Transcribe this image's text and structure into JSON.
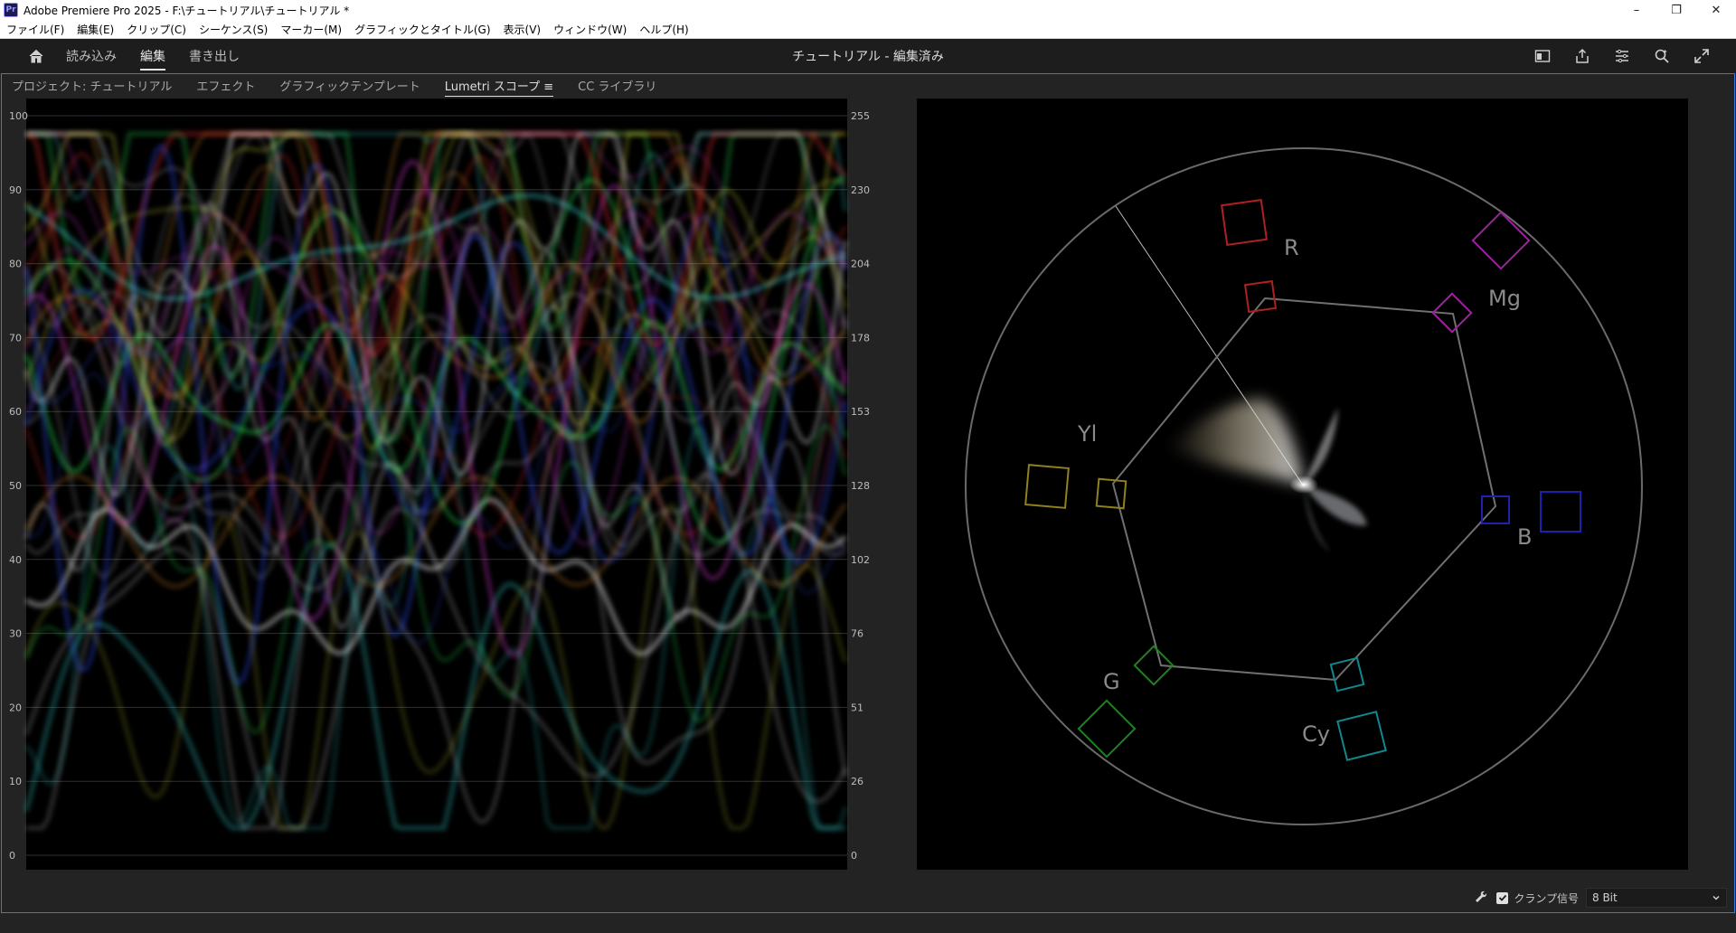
{
  "window": {
    "title": "Adobe Premiere Pro 2025 - F:\\チュートリアル\\チュートリアル *",
    "app_badge": "Pr"
  },
  "menu": [
    "ファイル(F)",
    "編集(E)",
    "クリップ(C)",
    "シーケンス(S)",
    "マーカー(M)",
    "グラフィックとタイトル(G)",
    "表示(V)",
    "ウィンドウ(W)",
    "ヘルプ(H)"
  ],
  "header": {
    "workspaces": [
      "読み込み",
      "編集",
      "書き出し"
    ],
    "active_workspace": "編集",
    "doc_title": "チュートリアル - 編集済み",
    "icons": [
      "panel-layout-icon",
      "share-icon",
      "workspace-menu-icon",
      "search-icon",
      "fullscreen-icon"
    ]
  },
  "panel_tabs": [
    "プロジェクト: チュートリアル",
    "エフェクト",
    "グラフィックテンプレート",
    "Lumetri スコープ ≡",
    "CC ライブラリ"
  ],
  "active_panel_tab": "Lumetri スコープ ≡",
  "waveform": {
    "left_axis": [
      "100",
      "90",
      "80",
      "70",
      "60",
      "50",
      "40",
      "30",
      "20",
      "10",
      "0"
    ],
    "right_axis": [
      "255",
      "230",
      "204",
      "178",
      "153",
      "128",
      "102",
      "76",
      "51",
      "26",
      "0"
    ]
  },
  "vectorscope": {
    "targets": [
      {
        "label": "R",
        "color": "#b02020"
      },
      {
        "label": "Mg",
        "color": "#a020a0"
      },
      {
        "label": "B",
        "color": "#2020b0"
      },
      {
        "label": "Cy",
        "color": "#108890"
      },
      {
        "label": "G",
        "color": "#208020"
      },
      {
        "label": "Yl",
        "color": "#908020"
      }
    ]
  },
  "footer": {
    "clamp_label": "クランプ信号",
    "clamp_checked": true,
    "bit_depth": "8 Bit"
  }
}
